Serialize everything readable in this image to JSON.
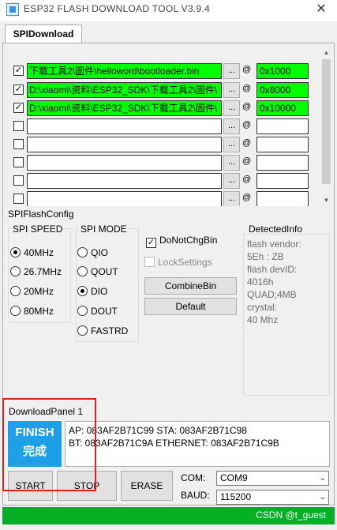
{
  "window": {
    "title": "ESP32 FLASH DOWNLOAD TOOL V3.9.4",
    "close": "✕"
  },
  "tab": {
    "label": "SPIDownload"
  },
  "files": [
    {
      "checked": "✓",
      "path": "下载工具2\\固件\\helloword\\bootloader.bin",
      "addr": "0x1000",
      "status_color": "#00ff00"
    },
    {
      "checked": "✓",
      "path": "D:\\xiaomi\\资料\\ESP32_SDK\\下载工具2\\固件\\",
      "addr": "0x8000",
      "status_color": "#00ff00"
    },
    {
      "checked": "✓",
      "path": "D:\\xiaomi\\资料\\ESP32_SDK\\下载工具2\\固件\\",
      "addr": "0x10000",
      "status_color": "#00ff00"
    },
    {
      "checked": "",
      "path": "",
      "addr": ""
    },
    {
      "checked": "",
      "path": "",
      "addr": ""
    },
    {
      "checked": "",
      "path": "",
      "addr": ""
    },
    {
      "checked": "",
      "path": "",
      "addr": ""
    },
    {
      "checked": "",
      "path": "",
      "addr": ""
    }
  ],
  "file_browse_label": "...",
  "at_label": "@",
  "spi_flash_config": {
    "label": "SPIFlashConfig",
    "speed_title": "SPI SPEED",
    "speeds": [
      {
        "label": "40MHz",
        "selected": true
      },
      {
        "label": "26.7MHz",
        "selected": false
      },
      {
        "label": "20MHz",
        "selected": false
      },
      {
        "label": "80MHz",
        "selected": false
      }
    ],
    "mode_title": "SPI MODE",
    "modes": [
      {
        "label": "QIO",
        "selected": false
      },
      {
        "label": "QOUT",
        "selected": false
      },
      {
        "label": "DIO",
        "selected": true
      },
      {
        "label": "DOUT",
        "selected": false
      },
      {
        "label": "FASTRD",
        "selected": false
      }
    ],
    "do_not_chg_bin": {
      "label": "DoNotChgBin",
      "checked": "✓"
    },
    "lock_settings": {
      "label": "LockSettings",
      "checked": ""
    },
    "combine_bin": "CombineBin",
    "default": "Default"
  },
  "detected_info": {
    "title": "DetectedInfo",
    "lines": [
      "flash vendor:",
      "5Eh : ZB",
      "flash devID:",
      "4016h",
      "QUAD;4MB",
      "crystal:",
      "40 Mhz"
    ]
  },
  "download_panel": {
    "label": "DownloadPanel 1",
    "status_l1": "FINISH",
    "status_l2": "完成",
    "status_color": "#1ea0e8",
    "log_l1": "AP:  083AF2B71C99  STA:  083AF2B71C98",
    "log_l2": "BT:  083AF2B71C9A  ETHERNET:  083AF2B71C9B",
    "start": "START",
    "stop": "STOP",
    "erase": "ERASE",
    "com_label": "COM:",
    "com_value": "COM9",
    "baud_label": "BAUD:",
    "baud_value": "115200",
    "progress": 1.0,
    "progress_color": "#06b025"
  },
  "watermark": "CSDN @t_guest"
}
